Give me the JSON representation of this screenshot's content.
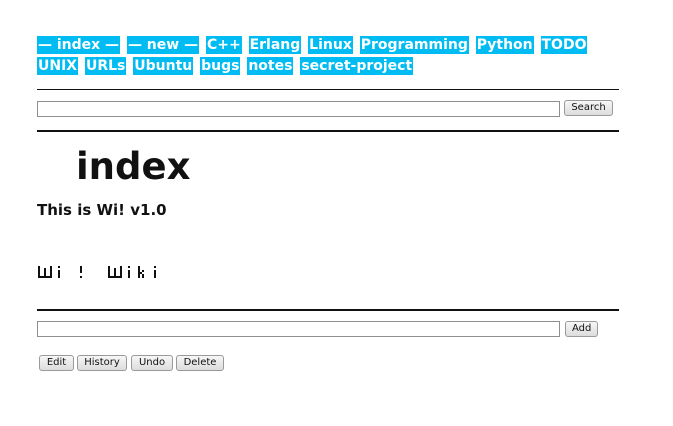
{
  "nav": {
    "links": [
      "— index —",
      "— new —",
      "C++",
      "Erlang",
      "Linux",
      "Programming",
      "Python",
      "TODO",
      "UNIX",
      "URLs",
      "Ubuntu",
      "bugs",
      "notes",
      "secret-project"
    ]
  },
  "search": {
    "value": "",
    "button_label": "Search"
  },
  "page": {
    "title": "index",
    "intro": "This is Wi! v1.0",
    "logo_text": "Wi! Wiki"
  },
  "add": {
    "value": "",
    "button_label": "Add"
  },
  "actions": {
    "edit_label": "Edit",
    "history_label": "History",
    "undo_label": "Undo",
    "delete_label": "Delete"
  },
  "colors": {
    "nav_background": "#00bcf2",
    "nav_text": "#ffffff",
    "text": "#111111"
  }
}
